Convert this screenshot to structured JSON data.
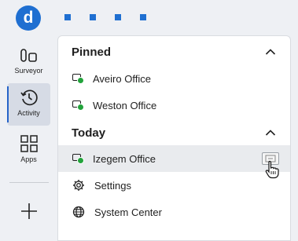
{
  "logo": {
    "letter": "d"
  },
  "rail": {
    "items": [
      {
        "label": "Surveyor"
      },
      {
        "label": "Activity"
      },
      {
        "label": "Apps"
      }
    ]
  },
  "panel": {
    "sections": [
      {
        "title": "Pinned",
        "items": [
          "Aveiro Office",
          "Weston Office"
        ]
      },
      {
        "title": "Today",
        "items": [
          "Izegem Office",
          "Settings",
          "System Center"
        ]
      }
    ]
  },
  "colors": {
    "accent": "#1f6fd1",
    "online": "#22a33b",
    "rail_active": "#d6dbe5"
  },
  "icons": [
    "surveyor-icon",
    "activity-history-icon",
    "apps-grid-icon",
    "add-icon",
    "chevron-up-icon",
    "gear-icon",
    "globe-icon",
    "site-status-icon"
  ]
}
